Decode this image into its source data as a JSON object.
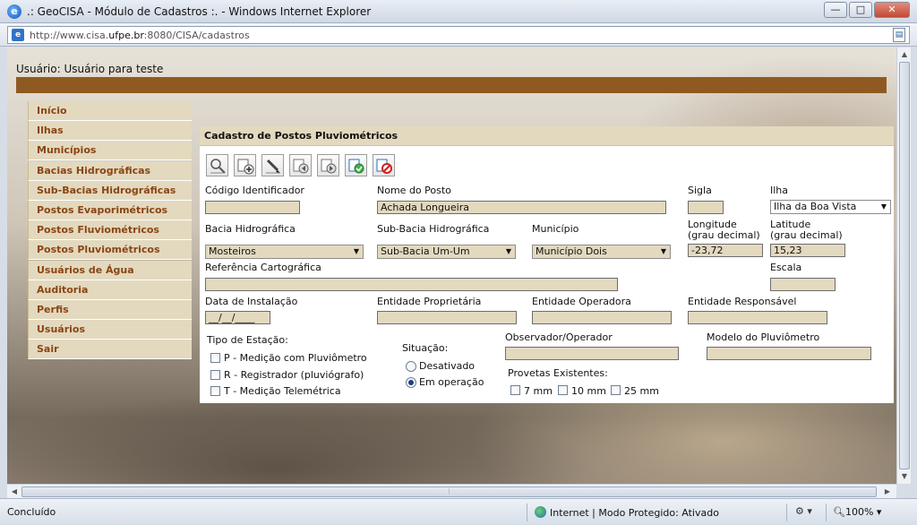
{
  "window": {
    "title": ".: GeoCISA - Módulo de Cadastros :. - Windows Internet Explorer",
    "btn_minimize": "—",
    "btn_maximize": "□",
    "btn_close": "✕"
  },
  "address": {
    "prefix": "http://www.cisa.",
    "domain": "ufpe.br",
    "suffix": ":8080/CISA/cadastros"
  },
  "header": {
    "user_label": "Usuário: Usuário para teste"
  },
  "menu": [
    {
      "label": "Início"
    },
    {
      "label": "Ilhas"
    },
    {
      "label": "Municípios"
    },
    {
      "label": "Bacias Hidrográficas"
    },
    {
      "label": "Sub-Bacias Hidrográficas"
    },
    {
      "label": "Postos Evaporimétricos"
    },
    {
      "label": "Postos Fluviométricos"
    },
    {
      "label": "Postos Pluviométricos"
    },
    {
      "label": "Usuários de Água"
    },
    {
      "label": "Auditoria"
    },
    {
      "label": "Perfis"
    },
    {
      "label": "Usuários"
    },
    {
      "label": "Sair"
    }
  ],
  "form": {
    "title": "Cadastro de Postos Pluviométricos",
    "toolbar_icons": [
      "search-icon",
      "add-icon",
      "edit-icon",
      "first-icon",
      "previous-icon",
      "confirm-icon",
      "delete-icon"
    ],
    "codigo": {
      "label": "Código Identificador",
      "value": ""
    },
    "nome_posto": {
      "label": "Nome do Posto",
      "value": "Achada Longueira"
    },
    "sigla": {
      "label": "Sigla",
      "value": ""
    },
    "ilha": {
      "label": "Ilha",
      "value": "Ilha da Boa Vista"
    },
    "bacia": {
      "label": "Bacia Hidrográfica",
      "value": "Mosteiros"
    },
    "sub_bacia": {
      "label": "Sub-Bacia Hidrográfica",
      "value": "Sub-Bacia Um-Um"
    },
    "municipio": {
      "label": "Município",
      "value": "Município Dois"
    },
    "longitude": {
      "label_1": "Longitude",
      "label_2": "(grau decimal)",
      "value": "-23,72"
    },
    "latitude": {
      "label_1": "Latitude",
      "label_2": "(grau decimal)",
      "value": "15,23"
    },
    "referencia": {
      "label": "Referência Cartográfica",
      "value": ""
    },
    "escala": {
      "label": "Escala",
      "value": ""
    },
    "data_instalacao": {
      "label": "Data de Instalação",
      "value": "__/__/____"
    },
    "entidade_proprietaria": {
      "label": "Entidade Proprietária",
      "value": ""
    },
    "entidade_operadora": {
      "label": "Entidade Operadora",
      "value": ""
    },
    "entidade_responsavel": {
      "label": "Entidade Responsável",
      "value": ""
    },
    "tipo_estacao": {
      "label": "Tipo de Estação:",
      "options": [
        {
          "label": "P - Medição com Pluviômetro",
          "checked": false
        },
        {
          "label": "R - Registrador (pluviógrafo)",
          "checked": false
        },
        {
          "label": "T - Medição Telemétrica",
          "checked": false
        }
      ]
    },
    "situacao": {
      "label": "Situação:",
      "options": [
        {
          "label": "Desativado",
          "selected": false
        },
        {
          "label": "Em operação",
          "selected": true
        }
      ]
    },
    "observador": {
      "label": "Observador/Operador",
      "value": ""
    },
    "modelo_pluviometro": {
      "label": "Modelo do Pluviômetro",
      "value": ""
    },
    "provetas": {
      "label": "Provetas Existentes:",
      "options": [
        {
          "label": "7 mm",
          "checked": false
        },
        {
          "label": "10 mm",
          "checked": false
        },
        {
          "label": "25 mm",
          "checked": false
        }
      ]
    }
  },
  "status": {
    "left": "Concluído",
    "zone": "Internet | Modo Protegido: Ativado",
    "zoom": "100%"
  },
  "colors": {
    "brown_bar": "#8f5a22",
    "menu_bg": "#e3d9bf",
    "menu_text": "#8b4513",
    "field_bg": "#e3d9bf"
  }
}
